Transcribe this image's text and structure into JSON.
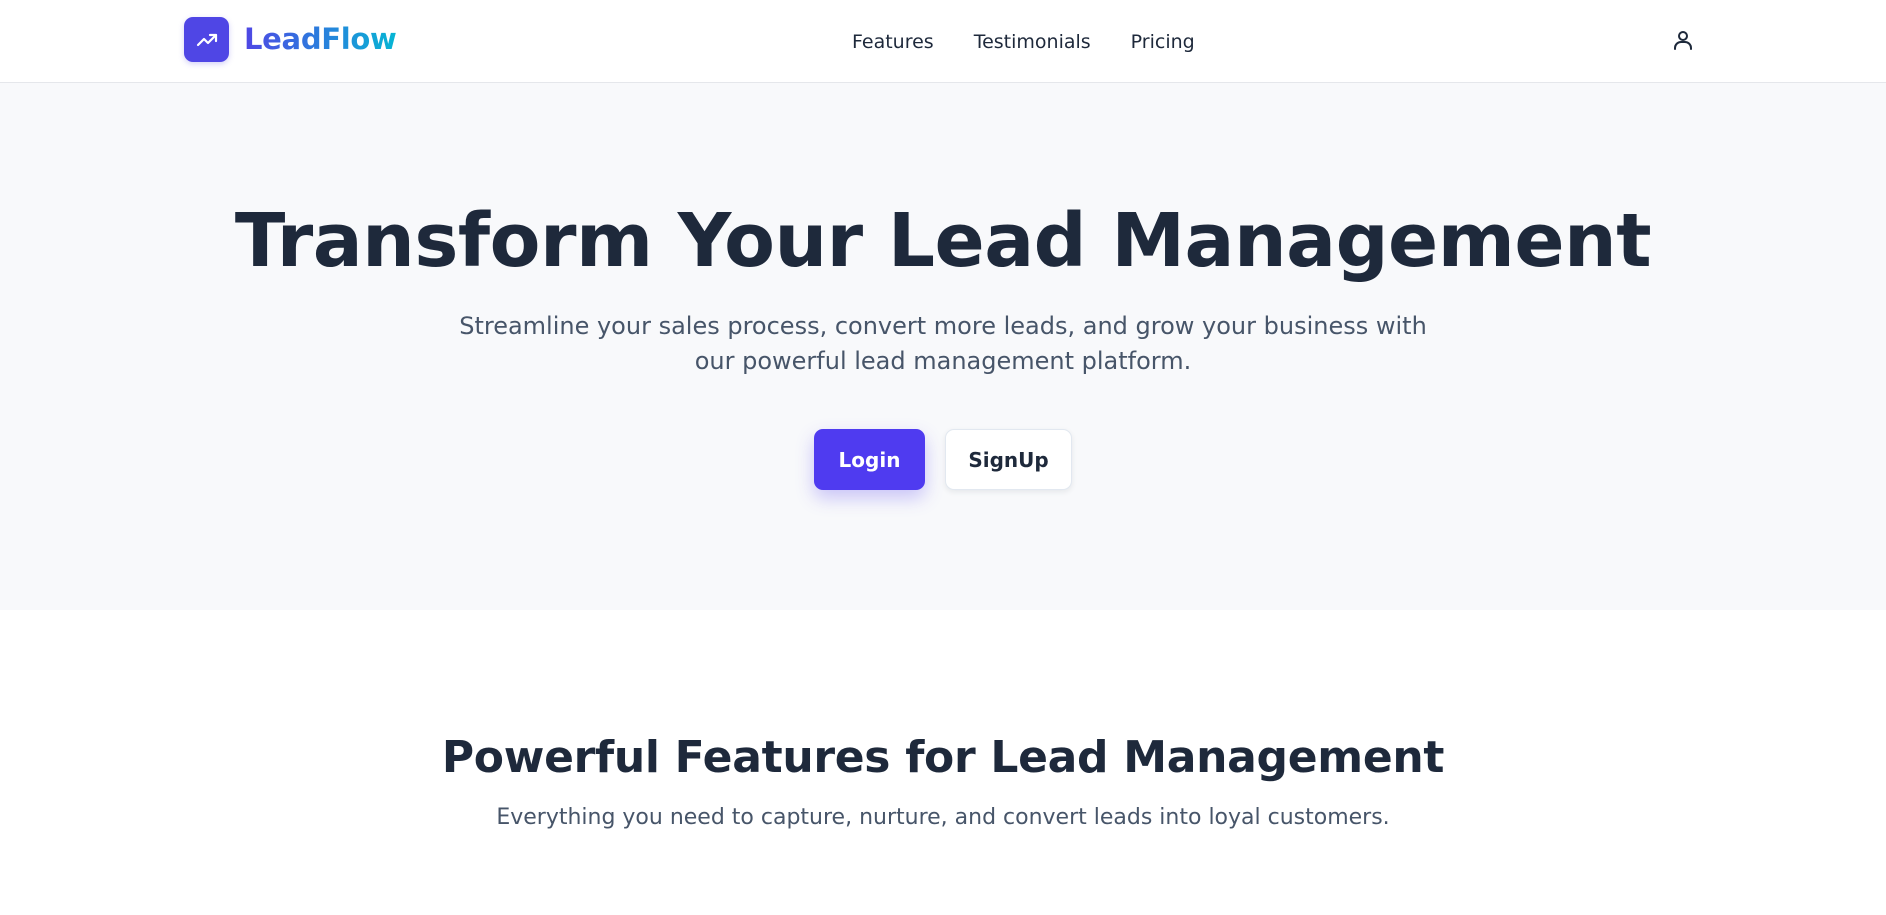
{
  "header": {
    "brand_name": "LeadFlow",
    "logo_icon": "trending-up-icon",
    "nav": [
      {
        "label": "Features"
      },
      {
        "label": "Testimonials"
      },
      {
        "label": "Pricing"
      }
    ],
    "user_icon": "user-icon"
  },
  "hero": {
    "title": "Transform Your Lead Management",
    "subtitle": "Streamline your sales process, convert more leads, and grow your business with our powerful lead management platform.",
    "login_label": "Login",
    "signup_label": "SignUp"
  },
  "features": {
    "title": "Powerful Features for Lead Management",
    "subtitle": "Everything you need to capture, nurture, and convert leads into loyal customers."
  },
  "colors": {
    "primary": "#4f46e5",
    "brand_gradient_end": "#06b6d4",
    "heading": "#1e293b",
    "body_text": "#475569",
    "hero_background": "#f8f9fb"
  }
}
